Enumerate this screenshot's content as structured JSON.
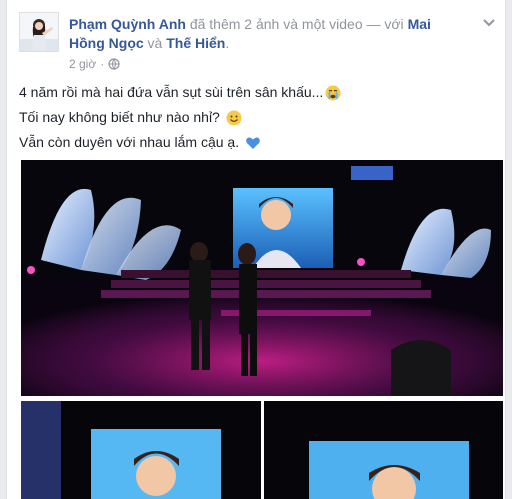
{
  "post": {
    "author": "Phạm Quỳnh Anh",
    "action": "đã thêm 2 ảnh và một video — với",
    "tagged_1": "Mai Hồng Ngọc",
    "conjunction": "và",
    "tagged_2": "Thế Hiển",
    "period": ".",
    "time": "2 giờ",
    "lines": [
      "4 năm rồi mà hai đứa vẫn sụt sùi trên sân khấu...",
      "Tối nay không biết như nào nhỉ?",
      "Vẫn còn duyên với nhau lắm cậu ạ."
    ],
    "emojis": [
      "crying-face",
      "smiling-face",
      "blue-heart"
    ]
  },
  "icons": {
    "privacy": "globe-icon",
    "menu": "chevron-down-icon"
  },
  "colors": {
    "link": "#365899",
    "meta": "#90949c",
    "text": "#1d2129",
    "heart": "#4a90e2",
    "stage_magenta": "#c2188c"
  }
}
